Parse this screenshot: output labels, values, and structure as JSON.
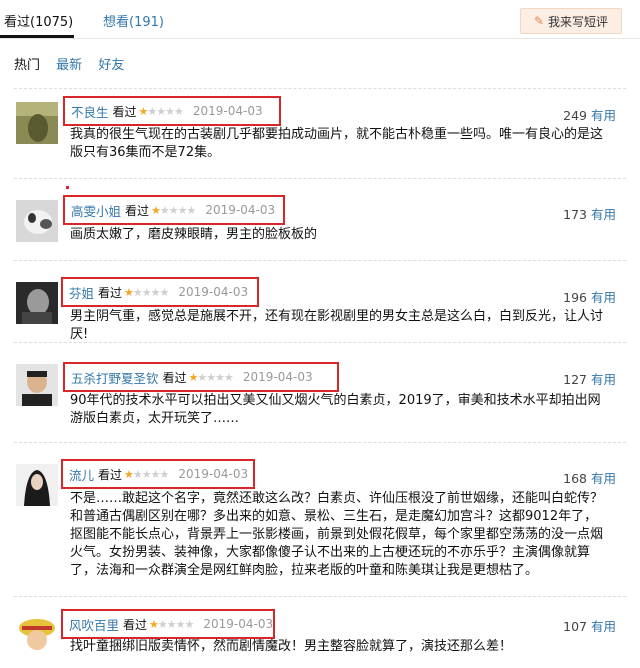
{
  "tabs": {
    "watched": "看过(1075)",
    "wish": "想看(191)"
  },
  "write_button": "我来写短评",
  "filters": [
    "热门",
    "最新",
    "好友"
  ],
  "colors": {
    "link": "#3377aa",
    "highlight_box": "#d9262b",
    "star": "#f6a623"
  },
  "reviews": [
    {
      "user": "不良生",
      "status": "看过",
      "rating": 1,
      "date": "2019-04-03",
      "votes": "249",
      "useful": "有用",
      "text": "我真的很生气现在的古装剧几乎都要拍成动画片，就不能古朴稳重一些吗。唯一有良心的是这版只有36集而不是72集。"
    },
    {
      "user": "高雯小姐",
      "status": "看过",
      "rating": 1,
      "date": "2019-04-03",
      "votes": "173",
      "useful": "有用",
      "text": "画质太嫩了，磨皮辣眼睛，男主的脸板板的"
    },
    {
      "user": "芬姐",
      "status": "看过",
      "rating": 1,
      "date": "2019-04-03",
      "votes": "196",
      "useful": "有用",
      "text": "男主阴气重，感觉总是施展不开，还有现在影视剧里的男女主总是这么白，白到反光，让人讨厌!"
    },
    {
      "user": "五杀打野夏圣钦",
      "status": "看过",
      "rating": 1,
      "date": "2019-04-03",
      "votes": "127",
      "useful": "有用",
      "text": "90年代的技术水平可以拍出又美又仙又烟火气的白素贞，2019了，审美和技术水平却拍出网游版白素贞，太开玩笑了……"
    },
    {
      "user": "流儿",
      "status": "看过",
      "rating": 1,
      "date": "2019-04-03",
      "votes": "168",
      "useful": "有用",
      "text": "不是……敢起这个名字，竟然还敢这么改？白素贞、许仙压根没了前世姻缘，还能叫白蛇传？和普通古偶剧区别在哪？多出来的如意、景松、三生石，是走魔幻加宫斗？这都9012年了，抠图能不能长点心，背景弄上一张影楼画，前景到处假花假草，每个家里都空荡荡的没一点烟火气。女扮男装、装神像，大家都像傻子认不出来的上古梗还玩的不亦乐乎？主演偶像就算了，法海和一众群演全是网红鲜肉脸，拉来老版的叶童和陈美琪让我是更想枯了。"
    },
    {
      "user": "风吹百里",
      "status": "看过",
      "rating": 1,
      "date": "2019-04-03",
      "votes": "107",
      "useful": "有用",
      "text": "找叶童捆绑旧版卖情怀，然而剧情魔改！男主整容脸就算了，演技还那么差！"
    }
  ]
}
